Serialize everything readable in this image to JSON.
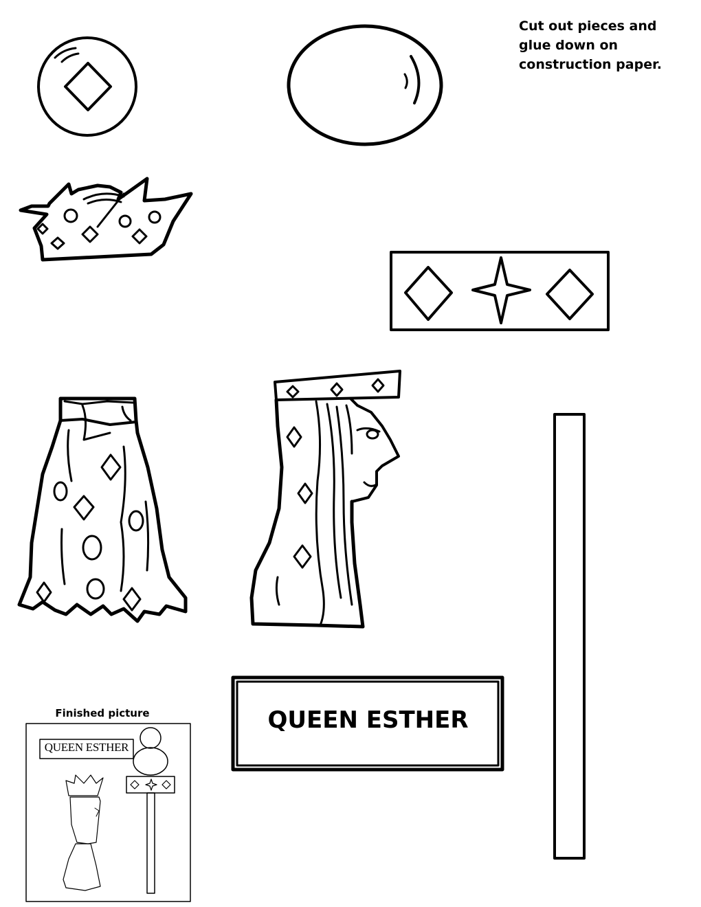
{
  "instructions": {
    "line1": "Cut out pieces and",
    "line2": "glue down on",
    "line3": "construction paper."
  },
  "name_plate": {
    "label": "QUEEN ESTHER"
  },
  "finished_picture": {
    "caption": "Finished picture",
    "mini_label": "QUEEN ESTHER"
  },
  "colors": {
    "ink": "#000000",
    "paper": "#ffffff"
  },
  "pieces": [
    "small-circle-with-diamond",
    "large-oval",
    "crown",
    "jeweled-band",
    "dress",
    "queen-head",
    "stick",
    "name-plate"
  ]
}
